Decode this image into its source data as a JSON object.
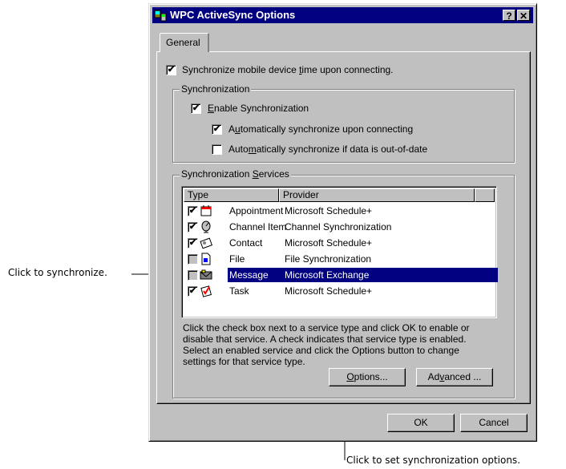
{
  "window": {
    "title": "WPC ActiveSync Options",
    "help_button": "?",
    "close_button": "✕"
  },
  "tabs": [
    {
      "label": "General"
    }
  ],
  "general": {
    "sync_time_label_pre": "Synchronize mobile device ",
    "sync_time_label_accel": "t",
    "sync_time_label_post": "ime upon connecting.",
    "sync_time_checked": true
  },
  "synchronization": {
    "legend": "Synchronization",
    "enable_accel": "E",
    "enable_post": "nable Synchronization",
    "enable_checked": true,
    "auto_connect_pre": "A",
    "auto_connect_accel": "u",
    "auto_connect_post": "tomatically synchronize upon connecting",
    "auto_connect_checked": true,
    "auto_outofdate_pre": "Auto",
    "auto_outofdate_accel": "m",
    "auto_outofdate_post": "atically synchronize if data is out-of-date",
    "auto_outofdate_checked": false
  },
  "services": {
    "legend_pre": "Synchronization ",
    "legend_accel": "S",
    "legend_post": "ervices",
    "columns": [
      "Type",
      "Provider"
    ],
    "rows": [
      {
        "type": "Appointment",
        "provider": "Microsoft Schedule+",
        "checked": true,
        "icon": "calendar-icon"
      },
      {
        "type": "Channel Item",
        "provider": "Channel Synchronization",
        "checked": true,
        "icon": "satellite-dish-icon"
      },
      {
        "type": "Contact",
        "provider": "Microsoft Schedule+",
        "checked": true,
        "icon": "contact-card-icon"
      },
      {
        "type": "File",
        "provider": "File Synchronization",
        "checked": false,
        "icon": "file-icon"
      },
      {
        "type": "Message",
        "provider": "Microsoft Exchange",
        "checked": false,
        "icon": "mail-icon",
        "selected": true
      },
      {
        "type": "Task",
        "provider": "Microsoft Schedule+",
        "checked": true,
        "icon": "task-icon"
      }
    ],
    "help_text": [
      "Click the check box next to a service type and click OK to enable or",
      "disable that service.  A check indicates that service type is enabled.",
      "Select an enabled service and click the Options button to change",
      "settings for that service type."
    ],
    "options_accel": "O",
    "options_post": "ptions...",
    "advanced_pre": "Ad",
    "advanced_accel": "v",
    "advanced_post": "anced ..."
  },
  "footer": {
    "ok": "OK",
    "cancel": "Cancel"
  },
  "callouts": {
    "left": "Click to synchronize.",
    "bottom": "Click to set synchronization options."
  },
  "colors": {
    "face": "#c0c0c0",
    "title": "#000080",
    "selection": "#000080"
  }
}
